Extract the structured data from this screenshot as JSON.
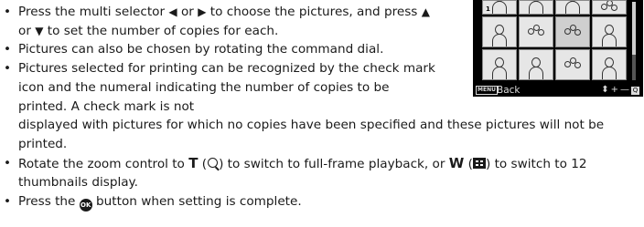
{
  "bullets": {
    "b1": {
      "t1": "Press the multi selector ",
      "sym_left": "◀",
      "t2": " or ",
      "sym_right": "▶",
      "t3": " to choose the pictures, and press ",
      "sym_up": "▲",
      "t4": " or ",
      "sym_down": "▼",
      "t5": " to set the number of copies for each."
    },
    "b2": "Pictures can also be chosen by rotating the command dial.",
    "b3": {
      "t1": "Pictures selected for printing can be recognized by the check mark icon and the numeral indicating the number of copies to be printed. A check mark is not",
      "t2": "displayed with pictures for which no copies have been specified and these pictures will not be printed."
    },
    "b4": {
      "t1": "Rotate the zoom control to ",
      "key_t": "T",
      "t2": " (",
      "t3": ") to switch to full-frame playback, or ",
      "key_w": "W",
      "t4": " (",
      "t5": ") to switch to 12 thumbnails display."
    },
    "b5": {
      "t1": "Press the ",
      "ok": "OK",
      "t2": " button when setting is complete."
    }
  },
  "screen": {
    "menu_badge": "MENU",
    "back_label": "Back",
    "copy_count": "1",
    "controls": {
      "updown": "⬍",
      "plus": "+",
      "dash": "—",
      "zoom": "Q"
    }
  },
  "colors": {
    "screen_bg": "#000000",
    "text": "#1a1a1a"
  }
}
